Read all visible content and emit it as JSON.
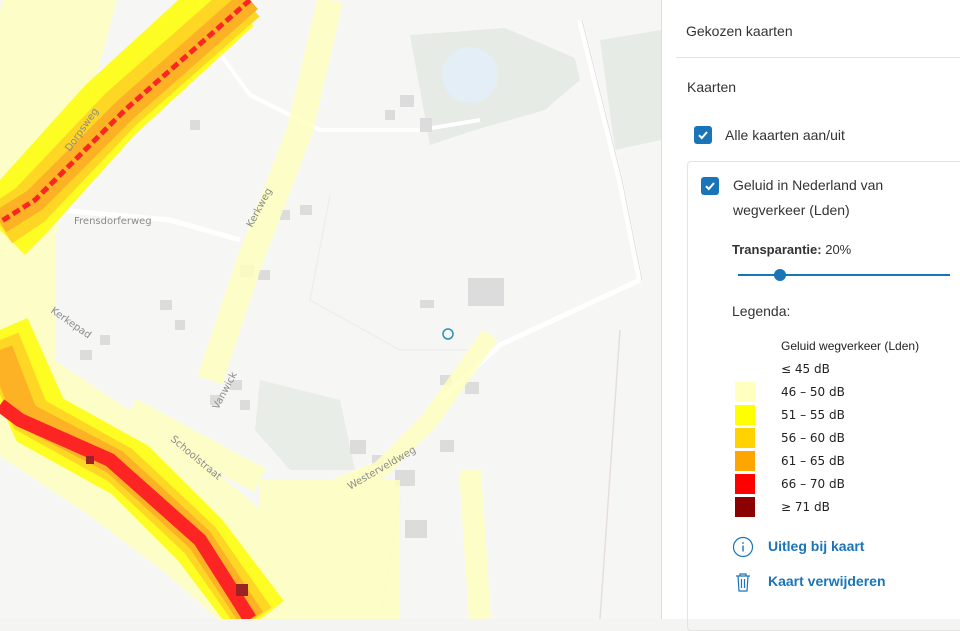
{
  "colors": {
    "accent": "#1a74b8",
    "noise_le45": "#ffffff",
    "noise_46_50": "#ffffc0",
    "noise_51_55": "#ffff00",
    "noise_56_60": "#ffd200",
    "noise_61_65": "#ffa500",
    "noise_66_70": "#ff0000",
    "noise_ge71": "#8b0000"
  },
  "map": {
    "road_labels": [
      "Frensdorferweg",
      "Kerkweg",
      "Kerkepad",
      "Dorpsweg",
      "Vanwick",
      "Schoolstraat",
      "Westerveldweg"
    ]
  },
  "panel": {
    "title": "Gekozen kaarten",
    "section_title": "Kaarten",
    "all_toggle": {
      "label": "Alle kaarten aan/uit",
      "checked": true
    },
    "layer": {
      "name_line1": "Geluid in Nederland van",
      "name_line2": "wegverkeer (Lden)",
      "checked": true,
      "transparency_label": "Transparantie:",
      "transparency_value": "20%",
      "transparency_fraction": 0.2,
      "legend_title": "Legenda:",
      "legend_heading": "Geluid wegverkeer (Lden)",
      "legend_items": [
        {
          "label": "≤ 45 dB",
          "color": "#ffffff"
        },
        {
          "label": "46 – 50 dB",
          "color": "#ffffc0"
        },
        {
          "label": "51 – 55 dB",
          "color": "#ffff00"
        },
        {
          "label": "56 – 60 dB",
          "color": "#ffd200"
        },
        {
          "label": "61 – 65 dB",
          "color": "#ffa500"
        },
        {
          "label": "66 – 70 dB",
          "color": "#ff0000"
        },
        {
          "label": "≥ 71 dB",
          "color": "#8b0000"
        }
      ],
      "info_link": "Uitleg bij kaart",
      "remove_link": "Kaart verwijderen",
      "info_icon": "info-icon",
      "remove_icon": "trash-icon"
    }
  }
}
